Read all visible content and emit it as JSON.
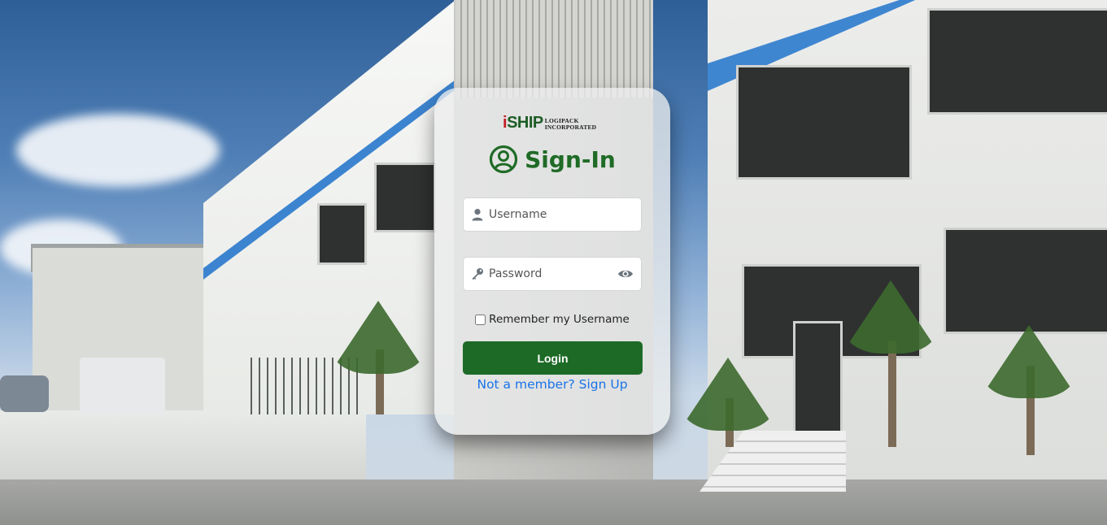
{
  "brand": {
    "logo_mark_i": "i",
    "logo_mark_rest": "SHIP",
    "logo_sub_line1": "LOGIPACK",
    "logo_sub_line2": "INCORPORATED"
  },
  "login": {
    "title": "Sign-In",
    "username_placeholder": "Username",
    "password_placeholder": "Password",
    "remember_label": "Remember my Username",
    "remember_checked": false,
    "login_label": "Login",
    "signup_text": "Not a member? Sign Up"
  },
  "icons": {
    "title": "user-circle-icon",
    "username": "user-icon",
    "password": "key-icon",
    "toggle_password": "eye-icon"
  },
  "colors": {
    "brand_green": "#1d6a27",
    "link_blue": "#1a73e8",
    "logo_red": "#c21d22"
  }
}
